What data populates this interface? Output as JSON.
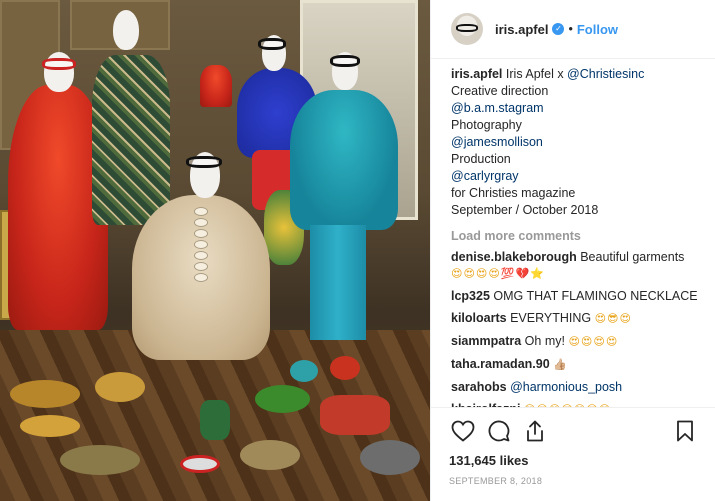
{
  "post": {
    "image_alt": "Mannequins in furs and couture surrounded by jewelry",
    "author": {
      "username": "iris.apfel",
      "verified_mark": "✓",
      "separator": "•",
      "follow_label": "Follow"
    },
    "caption": {
      "username": "iris.apfel",
      "lines": [
        "Iris Apfel x ",
        "@Christiesinc",
        "Creative direction",
        "@b.a.m.stagram",
        "Photography",
        "@jamesmollison",
        "Production",
        "@carlyrgray",
        "for Christies magazine",
        "September / October 2018"
      ]
    },
    "load_more_label": "Load more comments",
    "comments": [
      {
        "user": "denise.blakeborough",
        "text": "Beautiful garments",
        "emoji": "😍😍😍😍💯💔⭐"
      },
      {
        "user": "lcp325",
        "text": "OMG THAT FLAMINGO NECKLACE",
        "emoji": ""
      },
      {
        "user": "kiloloarts",
        "text": "EVERYTHING",
        "emoji": "😍😎😍"
      },
      {
        "user": "siammpatra",
        "text": "Oh my!",
        "emoji": "😍😍😍😍"
      },
      {
        "user": "taha.ramadan.90",
        "text": "",
        "emoji": "👍🏼"
      },
      {
        "user": "sarahobs",
        "text": "@harmonious_posh",
        "emoji": ""
      },
      {
        "user": "khairolfazni",
        "text": "",
        "emoji": "😍😍😍😍😍😍😍"
      }
    ],
    "actions": {
      "like_icon": "heart-icon",
      "comment_icon": "comment-icon",
      "share_icon": "share-icon",
      "save_icon": "bookmark-icon"
    },
    "likes_text": "131,645 likes",
    "date_text": "SEPTEMBER 8, 2018"
  }
}
